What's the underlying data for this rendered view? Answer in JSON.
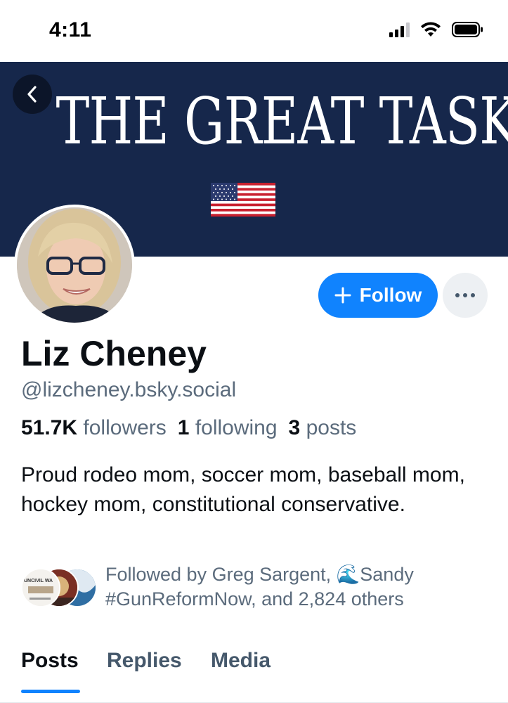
{
  "status_bar": {
    "time": "4:11"
  },
  "banner": {
    "title": "THE GREAT TASK",
    "background": "#16274b"
  },
  "profile": {
    "display_name": "Liz Cheney",
    "handle": "@lizcheney.bsky.social",
    "followers_count": "51.7K",
    "followers_label": "followers",
    "following_count": "1",
    "following_label": "following",
    "posts_count": "3",
    "posts_label": "posts",
    "bio": "Proud rodeo mom, soccer mom, baseball mom, hockey mom, constitutional conservative.",
    "known_followers_text": "Followed by Greg Sargent, 🌊Sandy #GunReformNow, and 2,824 others",
    "known_avatar_text": "UNCIVIL WA"
  },
  "actions": {
    "follow_label": "Follow",
    "accent": "#1083fe"
  },
  "tabs": [
    {
      "label": "Posts",
      "active": true
    },
    {
      "label": "Replies",
      "active": false
    },
    {
      "label": "Media",
      "active": false
    }
  ],
  "icons": [
    "back-chevron-icon",
    "plus-icon",
    "ellipsis-icon",
    "signal-icon",
    "wifi-icon",
    "battery-icon",
    "flag-icon"
  ]
}
